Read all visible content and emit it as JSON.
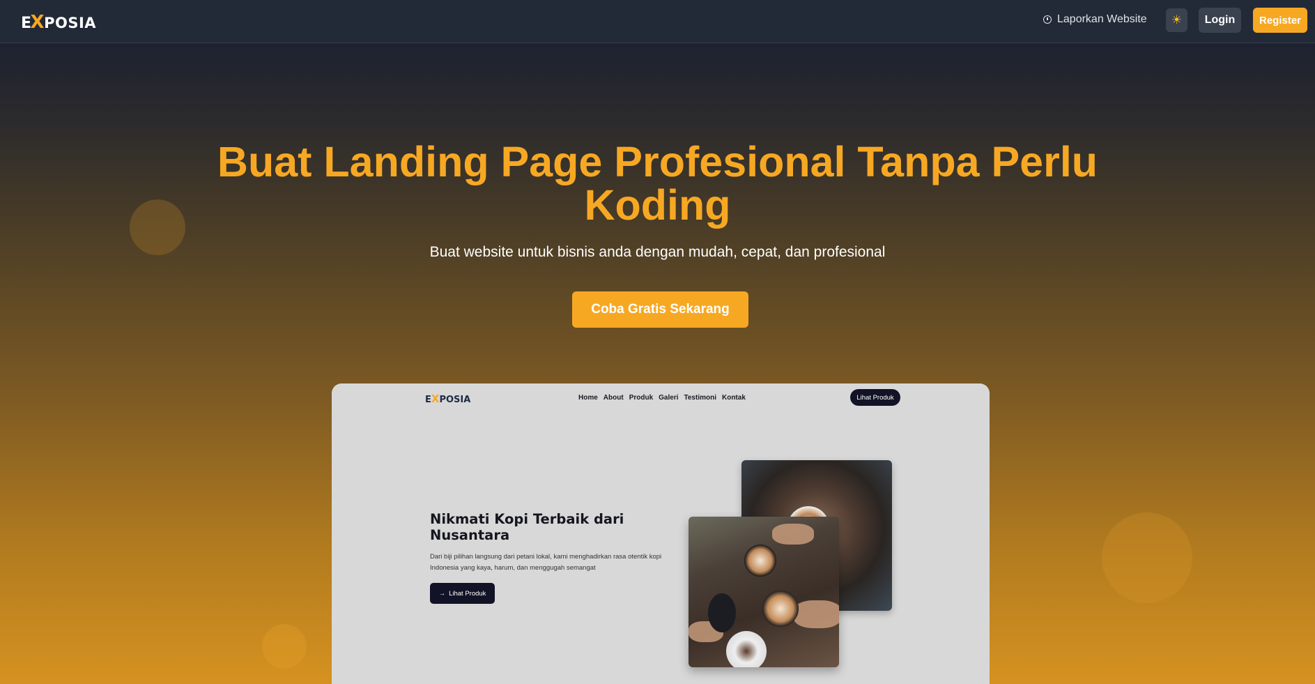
{
  "brand": {
    "logo_e": "E",
    "logo_x": "X",
    "logo_rest": "POSIA"
  },
  "nav": {
    "report_label": "Laporkan Website",
    "login_label": "Login",
    "register_label": "Register",
    "theme_icon": "☀"
  },
  "hero": {
    "title": "Buat Landing Page Profesional Tanpa Perlu Koding",
    "subtitle": "Buat website untuk bisnis anda dengan mudah, cepat, dan profesional",
    "cta_label": "Coba Gratis Sekarang"
  },
  "preview": {
    "menu": [
      "Home",
      "About",
      "Produk",
      "Galeri",
      "Testimoni",
      "Kontak"
    ],
    "top_button": "Lihat Produk",
    "heading": "Nikmati Kopi Terbaik dari Nusantara",
    "paragraph": "Dari biji pilihan langsung dari petani lokal, kami menghadirkan rasa otentik kopi Indonesia yang kaya, harum, dan menggugah semangat",
    "button_arrow": "→",
    "button_label": "Lihat Produk"
  },
  "colors": {
    "accent": "#f7a823",
    "nav_bg": "#222a37",
    "dark_button": "#121326"
  }
}
